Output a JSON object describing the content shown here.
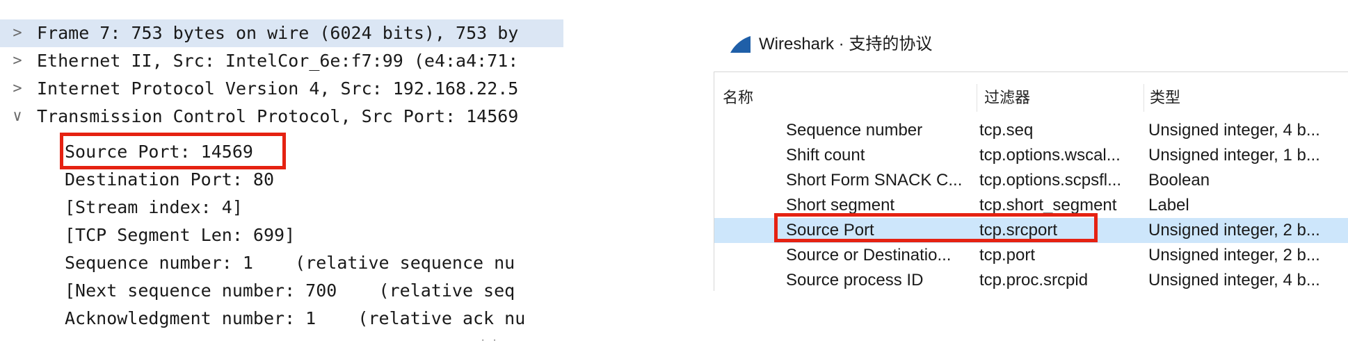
{
  "packet_details": {
    "rows": [
      {
        "chevron": ">",
        "text": "Frame 7: 753 bytes on wire (6024 bits), 753 by"
      },
      {
        "chevron": ">",
        "text": "Ethernet II, Src: IntelCor_6e:f7:99 (e4:a4:71:"
      },
      {
        "chevron": ">",
        "text": "Internet Protocol Version 4, Src: 192.168.22.5"
      },
      {
        "chevron": "∨",
        "text": "Transmission Control Protocol, Src Port: 14569"
      }
    ],
    "tcp_fields": [
      "Source Port: 14569",
      "Destination Port: 80",
      "[Stream index: 4]",
      "[TCP Segment Len: 699]",
      "Sequence number: 1    (relative sequence nu",
      "[Next sequence number: 700    (relative seq",
      "Acknowledgment number: 1    (relative ack nu"
    ]
  },
  "dialog": {
    "title": "Wireshark · 支持的协议",
    "columns": {
      "name": "名称",
      "filter": "过滤器",
      "type": "类型"
    },
    "rows": [
      {
        "name": "Sequence number",
        "filter": "tcp.seq",
        "type": "Unsigned integer, 4 b..."
      },
      {
        "name": "Shift count",
        "filter": "tcp.options.wscal...",
        "type": "Unsigned integer, 1 b..."
      },
      {
        "name": "Short Form SNACK C...",
        "filter": "tcp.options.scpsfl...",
        "type": "Boolean"
      },
      {
        "name": "Short segment",
        "filter": "tcp.short_segment",
        "type": "Label"
      },
      {
        "name": "Source Port",
        "filter": "tcp.srcport",
        "type": "Unsigned integer, 2 b...",
        "selected": true
      },
      {
        "name": "Source or Destinatio...",
        "filter": "tcp.port",
        "type": "Unsigned integer, 2 b..."
      },
      {
        "name": "Source process ID",
        "filter": "tcp.proc.srcpid",
        "type": "Unsigned integer, 4 b..."
      }
    ]
  },
  "colors": {
    "highlight": "#e52212",
    "selection": "#cde6fb",
    "header_band": "#e3ecf7",
    "logo": "#1f5fa8"
  },
  "icons": {
    "dialog_logo": "wireshark-fin-icon",
    "expand": "chevron-right-icon",
    "collapse": "chevron-down-icon"
  }
}
